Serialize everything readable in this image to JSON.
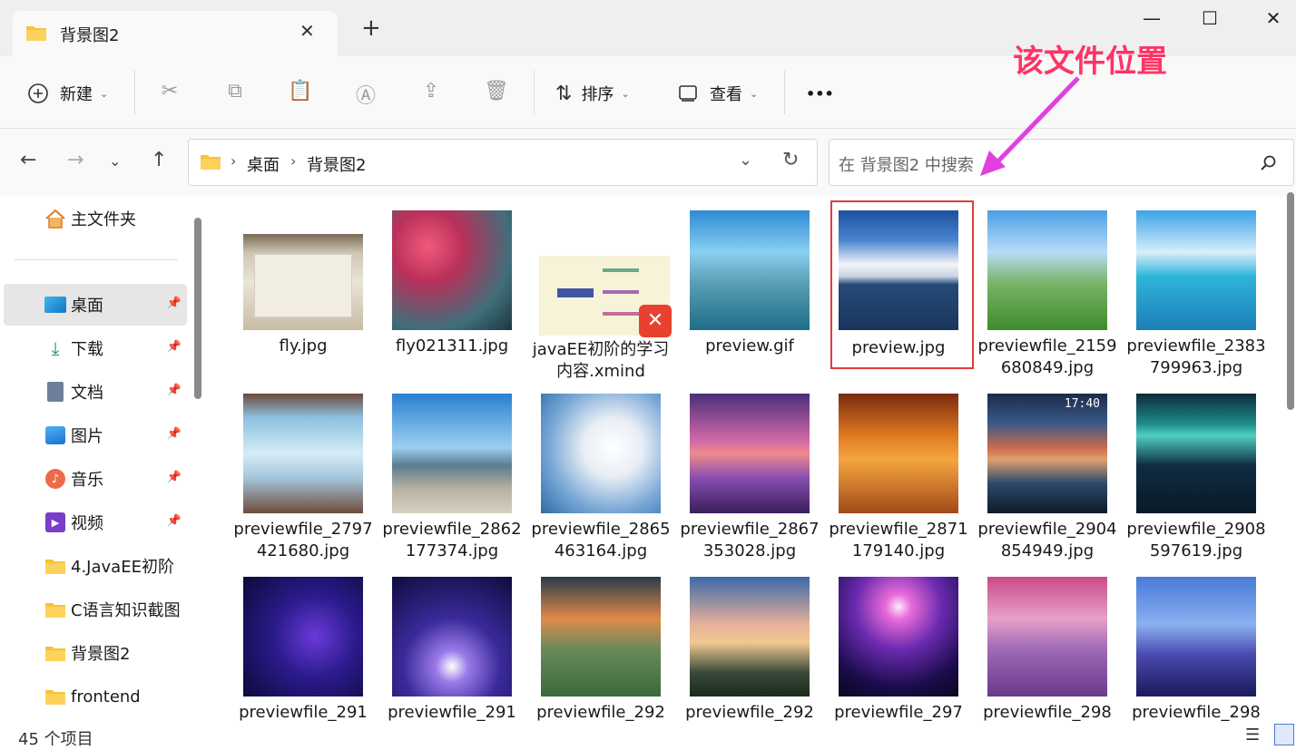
{
  "tab": {
    "title": "背景图2"
  },
  "toolbar": {
    "new_label": "新建",
    "sort_label": "排序",
    "view_label": "查看",
    "more_label": "•••"
  },
  "address": {
    "crumbs": [
      "桌面",
      "背景图2"
    ],
    "search_placeholder": "在 背景图2 中搜索"
  },
  "sidebar": {
    "home": "主文件夹",
    "items": [
      {
        "label": "桌面",
        "icon": "desktop-icon",
        "pinned": true,
        "selected": true
      },
      {
        "label": "下载",
        "icon": "download-icon",
        "pinned": true
      },
      {
        "label": "文档",
        "icon": "document-icon",
        "pinned": true
      },
      {
        "label": "图片",
        "icon": "pictures-icon",
        "pinned": true
      },
      {
        "label": "音乐",
        "icon": "music-icon",
        "pinned": true
      },
      {
        "label": "视频",
        "icon": "video-icon",
        "pinned": true
      },
      {
        "label": "4.JavaEE初阶",
        "icon": "folder-icon"
      },
      {
        "label": "C语言知识截图",
        "icon": "folder-icon"
      },
      {
        "label": "背景图2",
        "icon": "folder-icon"
      },
      {
        "label": "frontend",
        "icon": "folder-icon"
      }
    ]
  },
  "files": [
    {
      "name": "fly.jpg"
    },
    {
      "name": "fly021311.jpg"
    },
    {
      "name": "javaEE初阶的学习内容.xmind"
    },
    {
      "name": "preview.gif"
    },
    {
      "name": "preview.jpg"
    },
    {
      "name": "previewfile_2159680849.jpg"
    },
    {
      "name": "previewfile_2383799963.jpg"
    },
    {
      "name": "previewfile_2797421680.jpg"
    },
    {
      "name": "previewfile_2862177374.jpg"
    },
    {
      "name": "previewfile_2865463164.jpg"
    },
    {
      "name": "previewfile_2867353028.jpg"
    },
    {
      "name": "previewfile_2871179140.jpg"
    },
    {
      "name": "previewfile_2904854949.jpg"
    },
    {
      "name": "previewfile_2908597619.jpg"
    },
    {
      "name": "previewfile_291"
    },
    {
      "name": "previewfile_291"
    },
    {
      "name": "previewfile_292"
    },
    {
      "name": "previewfile_292"
    },
    {
      "name": "previewfile_297"
    },
    {
      "name": "previewfile_298"
    },
    {
      "name": "previewfile_298"
    }
  ],
  "status": {
    "count": "45 个项目"
  },
  "annotation": {
    "text": "该文件位置",
    "color": "#ff3366"
  },
  "thumb_clock": "17:40"
}
